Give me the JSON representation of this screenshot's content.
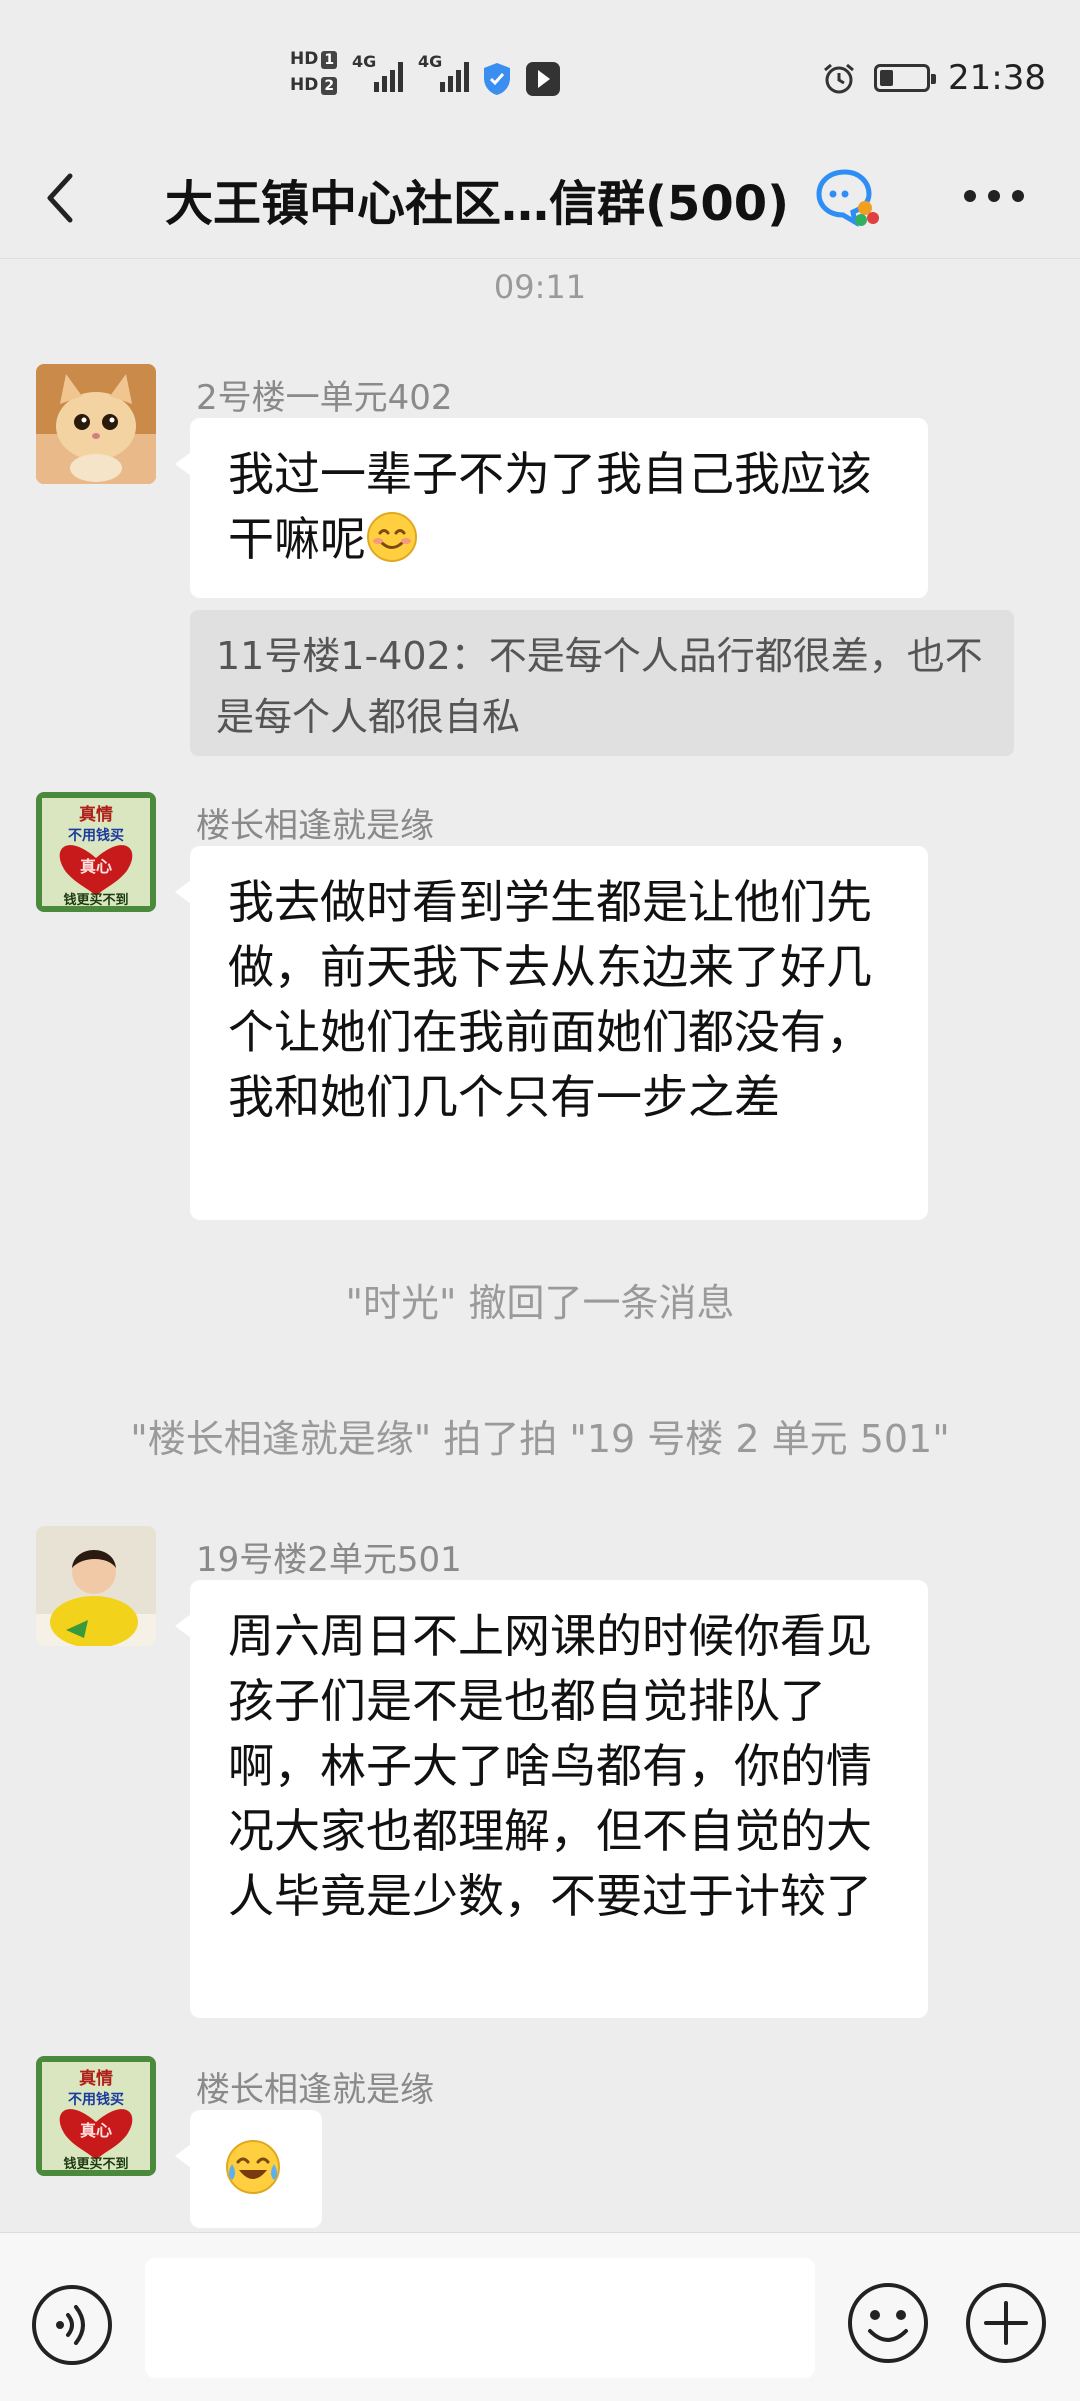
{
  "status_bar": {
    "hd1": "HD",
    "hd1_num": "1",
    "hd2": "HD",
    "hd2_num": "2",
    "signal1_label": "4G",
    "signal2_label": "4G",
    "time": "21:38",
    "battery_level": 0.25,
    "icons": [
      "hd-icon",
      "signal-icon",
      "signal-icon",
      "shield-icon",
      "app-icon",
      "alarm-icon",
      "battery-icon"
    ]
  },
  "header": {
    "title": "大王镇中心社区…信群(500)",
    "icons": [
      "back-icon",
      "group-chat-icon",
      "more-icon"
    ]
  },
  "chat": {
    "timestamp": "09:11",
    "messages": [
      {
        "sender": "2号楼一单元402",
        "text": "我过一辈子不为了我自己我应该干嘛呢",
        "emoji": "smile",
        "quote": "11号楼1-402：不是每个人品行都很差，也不是每个人都很自私"
      },
      {
        "sender": "楼长相逢就是缘",
        "text": "我去做时看到学生都是让他们先做，前天我下去从东边来了好几个让她们在我前面她们都没有，我和她们几个只有一步之差"
      },
      {
        "sender": "19号楼2单元501",
        "text": "周六周日不上网课的时候你看见孩子们是不是也都自觉排队了啊，林子大了啥鸟都有，你的情况大家也都理解，但不自觉的大人毕竟是少数，不要过于计较了"
      },
      {
        "sender": "楼长相逢就是缘",
        "emoji": "laugh-cry"
      }
    ],
    "system": {
      "recall": "\"时光\" 撤回了一条消息",
      "pat": "\"楼长相逢就是缘\" 拍了拍 \"19 号楼 2 单元 501\""
    },
    "avatar_sticker": {
      "line1": "真情",
      "line2": "不用钱买",
      "line3": "真心",
      "line4": "钱更买不到"
    }
  },
  "input_bar": {
    "placeholder": "",
    "icons": [
      "voice-icon",
      "emoji-icon",
      "plus-icon"
    ]
  },
  "colors": {
    "background": "#ededed",
    "bubble": "#ffffff",
    "quote_bg": "#e0e0e0",
    "system_text": "#9a9a9a"
  }
}
